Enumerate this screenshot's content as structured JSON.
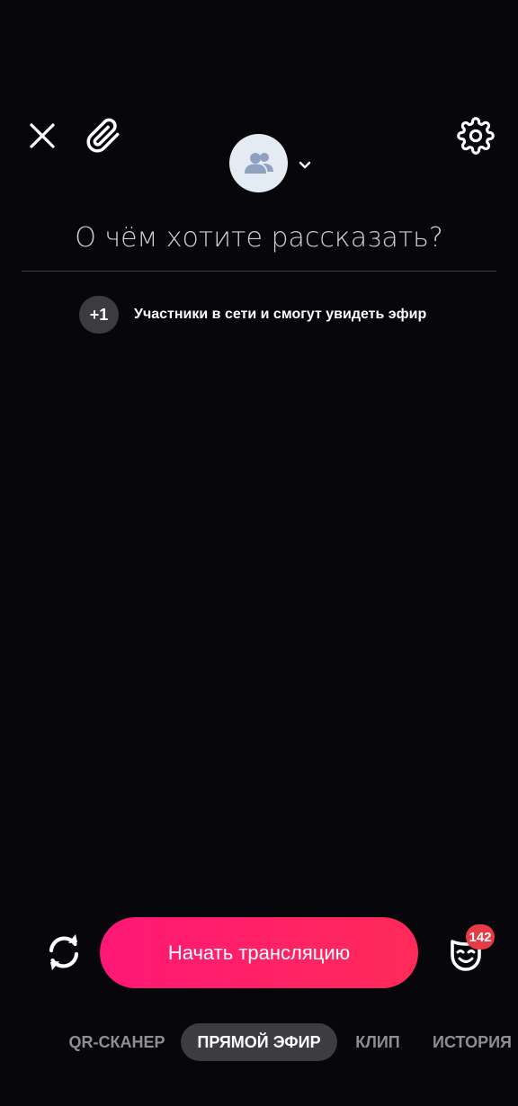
{
  "header": {
    "close_icon": "close-icon",
    "attach_icon": "paperclip-icon",
    "settings_icon": "gear-icon",
    "audience_icon": "group-avatar-icon",
    "dropdown_icon": "chevron-down-icon"
  },
  "composer": {
    "placeholder": "О чём хотите рассказать?",
    "value": ""
  },
  "viewers": {
    "count_label": "+1",
    "text": "Участники в сети и смогут увидеть эфир"
  },
  "controls": {
    "start_label": "Начать трансляцию",
    "flip_icon": "camera-flip-icon",
    "masks_icon": "mask-icon",
    "masks_badge": "142",
    "accent_color": "#ff1e6e",
    "badge_color": "#e63c46"
  },
  "modes": {
    "items": [
      {
        "label": "QR-СКАНЕР",
        "active": false
      },
      {
        "label": "ПРЯМОЙ ЭФИР",
        "active": true
      },
      {
        "label": "КЛИП",
        "active": false
      },
      {
        "label": "ИСТОРИЯ",
        "active": false
      }
    ]
  }
}
